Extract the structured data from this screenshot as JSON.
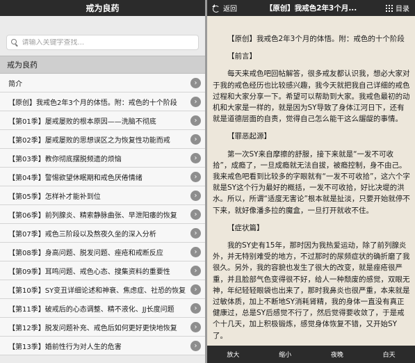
{
  "left": {
    "title": "戒为良药",
    "search_placeholder": "请输入关键字查找...",
    "section_title": "戒为良药",
    "items": [
      "简介",
      "【原创】我戒色2年3个月的体悟。附：戒色的十个阶段",
      "【第01季】屡戒屡败的根本原因——洗脑不彻底",
      "【第02季】屡戒屡败的思想误区之为恢复性功能而戒",
      "【第03季】教你彻底摆脱频遗的烦恼",
      "【第04季】警惕欲望休眠期和戒色厌倦情绪",
      "【第05季】怎样补才能补到位",
      "【第06季】前列腺炎、精索静脉曲张、早泄阳痿的恢复",
      "【第07季】戒色三阶段以及熬夜久坐的深入分析",
      "【第08季】身高问题、脱发问题、痤疮和戒断反应",
      "【第09季】耳鸣问题、戒色心态、搜集资料的重要性",
      "【第10季】SY变丑详细论述和神衰、焦虑症、社恐的恢复",
      "【第11季】破戒后的心态调整、精不液化、JJ长度问题",
      "【第12季】脱发问题补充、戒色后如何更好更快地恢复",
      "【第13季】婚前性行为对人生的危害"
    ]
  },
  "right": {
    "back_label": "返回",
    "title": "【原创】我戒色2年3个月...",
    "toc_label": "目录",
    "paragraphs": [
      {
        "text": "【原创】我戒色2年3个月的体悟。附：戒色的十个阶段",
        "indent": true
      },
      {
        "text": "【前言】",
        "indent": true
      },
      {
        "text": "每天来戒色吧回帖解答，很多戒友都认识我，想必大家对于我的戒色经历也比较感兴趣，我今天就把我自己详细的戒色过程和大家分享一下。希望可以帮助到大家。我戒色最初的动机和大家是一样的，就是因为SY导致了身体江河日下，还有就是道德层面的自责，觉得自己怎么能干这么龌龊的事情。",
        "indent": true
      },
      {
        "text": "【罪恶起源】",
        "indent": true
      },
      {
        "text": "第一次SY来自摩擦的舒服，接下来就是“一发不可收拾”，成瘾了，一旦成瘾就无法自拔，被瘾控制，身不由己。我来戒色吧看到比较多的字眼就有“一发不可收拾”，这六个字就是SY这个行为最好的概括，一发不可收拾，好比决堤的洪水。所以，所谓“适度无害论”根本就是扯淡，只要开始就停不下来，就好像潘多拉的魔盒，一旦打开就收不住。",
        "indent": true
      },
      {
        "text": "【症状篇】",
        "indent": true
      },
      {
        "text": "我的SY史有15年，那时因为我热爱运动，除了前列腺炎外，并无特别难受的地方，不过那时的尿频症状的确折磨了我很久。另外，我的容貌也发生了很大的改变，就是痤疮很严重，并且脸部气色变得很不好，给人一种颓废的感觉，双眼无神，年纪轻轻眼袋也出来了，那时我鼻炎也很严重，本来就是过敏体质，加上不断地SY消耗肾精，我的身体一直没有真正健康过，总是SY后感觉不行了，然后觉得要收敛了，于是戒个十几天，加上积极锻炼，感觉身体恢复不错，又开始SY了。",
        "indent": true
      }
    ],
    "bottom_buttons": [
      "放大",
      "缩小",
      "夜晚",
      "白天"
    ]
  },
  "colors": {
    "bar": "#2b2b2b",
    "list_bg": "#f7f7f7",
    "article_bg": "#ede7db",
    "chevron": "#8e8e8e"
  },
  "icons": {
    "search": "search-icon",
    "chevron": "chevron-right-icon",
    "back": "back-arrow-icon",
    "toc": "grid-menu-icon"
  }
}
